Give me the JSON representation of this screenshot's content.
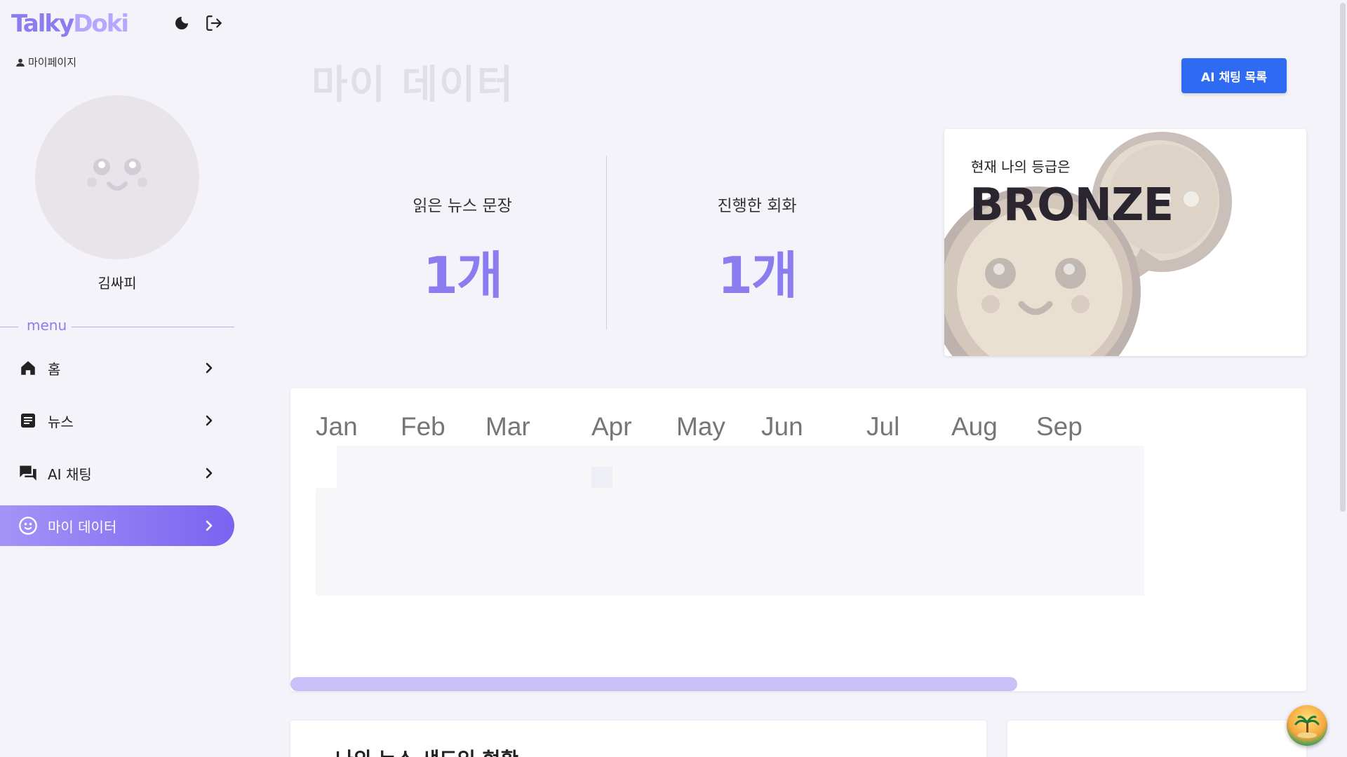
{
  "app": {
    "logo_part1": "Talky",
    "logo_part2": "Doki"
  },
  "sidebar": {
    "mypage_link": "마이페이지",
    "username": "김싸피",
    "menu_label": "menu",
    "items": [
      {
        "label": "홈",
        "icon": "home-icon"
      },
      {
        "label": "뉴스",
        "icon": "news-icon"
      },
      {
        "label": "AI 채팅",
        "icon": "chat-icon"
      },
      {
        "label": "마이 데이터",
        "icon": "face-icon",
        "active": true
      }
    ]
  },
  "header": {
    "title": "마이 데이터",
    "ai_chat_button": "AI 채팅 목록"
  },
  "stats": {
    "read_label": "읽은 뉴스 문장",
    "read_value": "1개",
    "conv_label": "진행한 회화",
    "conv_value": "1개"
  },
  "grade": {
    "label": "현재 나의 등급은",
    "value": "BRONZE"
  },
  "heatmap": {
    "months": [
      "Jan",
      "Feb",
      "Mar",
      "Apr",
      "May",
      "Jun",
      "Jul",
      "Aug",
      "Sep"
    ],
    "active_cells": [
      {
        "week": 13,
        "day": 1,
        "level": 1
      }
    ]
  },
  "bottom": {
    "left_title": "나의 뉴스 섀도잉 현황"
  },
  "colors": {
    "accent": "#8b7cf0",
    "primary_button": "#2f6bf2"
  }
}
